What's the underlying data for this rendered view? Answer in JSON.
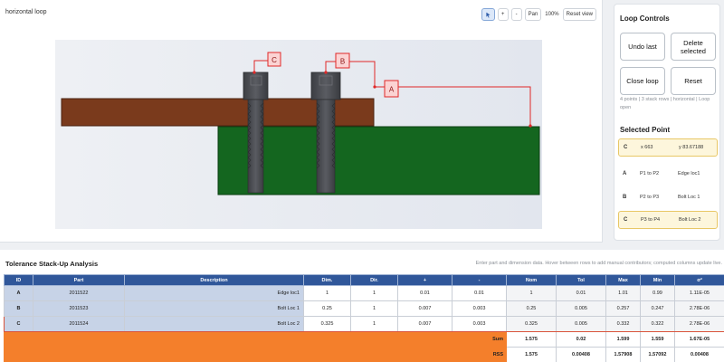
{
  "canvas": {
    "title": "horizontal loop",
    "toolbar": {
      "pointer_icon": "cursor-icon",
      "plus": "+",
      "minus": "-",
      "pan": "Pan",
      "zoom": "100%",
      "reset": "Reset view"
    },
    "callouts": [
      {
        "label": "C"
      },
      {
        "label": "B"
      },
      {
        "label": "A"
      }
    ],
    "colors": {
      "bar": "#7a3a1c",
      "block": "#14661f",
      "bolt": "#4b4d53",
      "callout": "#e02828",
      "callout_fill": "#fbd3d3"
    }
  },
  "loop_controls": {
    "title": "Loop Controls",
    "buttons": {
      "undo": "Undo last",
      "delete": "Delete selected",
      "close": "Close loop",
      "reset": "Reset"
    },
    "status": "4 points | 3 stack rows | horizontal | Loop open"
  },
  "selected_point": {
    "title": "Selected Point",
    "current": {
      "id": "C",
      "x": "x 663",
      "y": "y 83.67188"
    },
    "rows": [
      {
        "id": "A",
        "span": "P1 to P2",
        "name": "Edge loc1"
      },
      {
        "id": "B",
        "span": "P2 to P3",
        "name": "Bolt Loc 1"
      },
      {
        "id": "C",
        "span": "P3 to P4",
        "name": "Bolt Loc 2"
      }
    ]
  },
  "analysis": {
    "title": "Tolerance Stack-Up Analysis",
    "hint": "Enter part and dimension data. Hover between rows to add manual contributors; computed columns update live.",
    "headers": [
      "ID",
      "Part",
      "Description",
      "Dim.",
      "Dir.",
      "+",
      "-",
      "Nom",
      "Tol",
      "Max",
      "Min",
      "σ²"
    ],
    "rows": [
      {
        "id": "A",
        "part": "2011522",
        "desc": "Edge loc1",
        "dim": "1",
        "dir": "1",
        "plus": "0.01",
        "minus": "0.01",
        "nom": "1",
        "tol": "0.01",
        "max": "1.01",
        "min": "0.99",
        "var": "1.11E-05"
      },
      {
        "id": "B",
        "part": "2011523",
        "desc": "Bolt Loc 1",
        "dim": "0.25",
        "dir": "1",
        "plus": "0.007",
        "minus": "0.003",
        "nom": "0.25",
        "tol": "0.005",
        "max": "0.257",
        "min": "0.247",
        "var": "2.78E-06"
      },
      {
        "id": "C",
        "part": "2011524",
        "desc": "Bolt Loc 2",
        "dim": "0.325",
        "dir": "1",
        "plus": "0.007",
        "minus": "0.003",
        "nom": "0.325",
        "tol": "0.005",
        "max": "0.332",
        "min": "0.322",
        "var": "2.78E-06"
      }
    ],
    "sum": {
      "label": "Sum",
      "nom": "1.575",
      "tol": "0.02",
      "max": "1.599",
      "min": "1.559",
      "var": "1.67E-05"
    },
    "rss": {
      "label": "RSS",
      "nom": "1.575",
      "tol": "0.00408",
      "max": "1.57908",
      "min": "1.57092",
      "var": "0.00408"
    }
  }
}
